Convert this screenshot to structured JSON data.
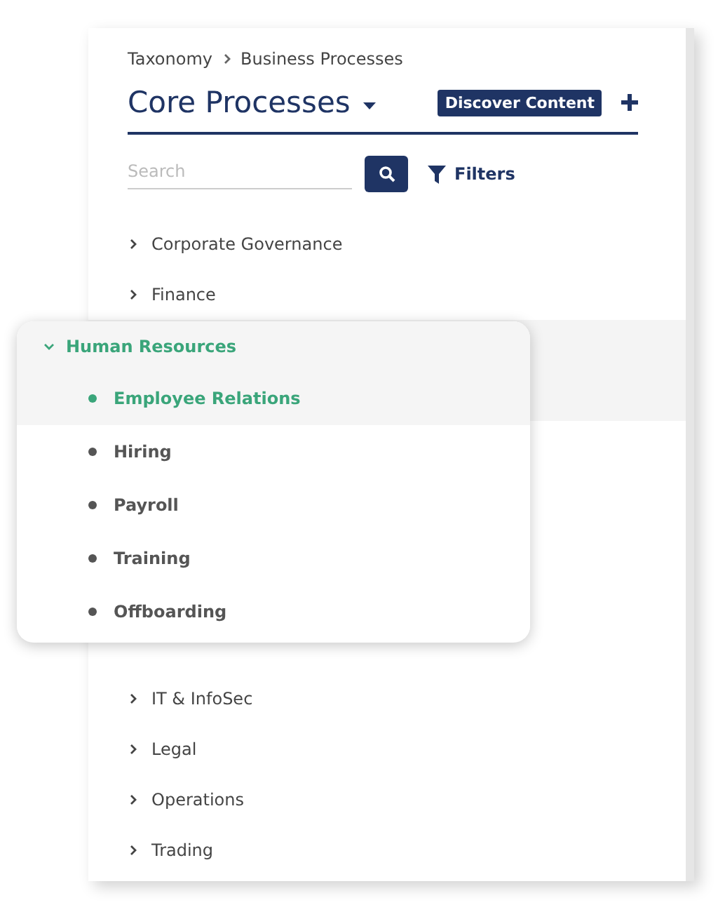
{
  "breadcrumb": [
    "Taxonomy",
    "Business Processes"
  ],
  "title": "Core Processes",
  "discover_button": "Discover Content",
  "search": {
    "placeholder": "Search"
  },
  "filters": "Filters",
  "categories": [
    {
      "label": "Corporate Governance",
      "expanded": false
    },
    {
      "label": "Finance",
      "expanded": false
    },
    {
      "label": "Human Resources",
      "expanded": true,
      "children": [
        {
          "label": "Employee Relations",
          "selected": true
        },
        {
          "label": "Hiring",
          "selected": false
        },
        {
          "label": "Payroll",
          "selected": false
        },
        {
          "label": "Training",
          "selected": false
        },
        {
          "label": "Offboarding",
          "selected": false
        }
      ]
    },
    {
      "label": "IT & InfoSec",
      "expanded": false
    },
    {
      "label": "Legal",
      "expanded": false
    },
    {
      "label": "Operations",
      "expanded": false
    },
    {
      "label": "Trading",
      "expanded": false
    }
  ]
}
